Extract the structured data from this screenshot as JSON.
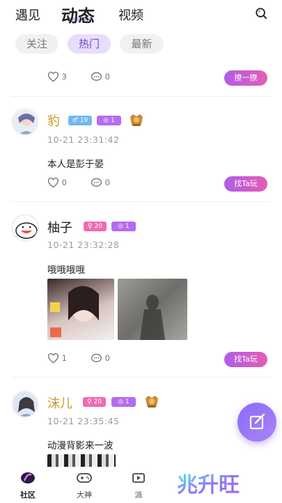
{
  "top_tabs": [
    "遇见",
    "动态",
    "视频"
  ],
  "filter_chips": [
    "关注",
    "热门",
    "最新"
  ],
  "posts": [
    {
      "likes": "3",
      "comments": "0",
      "button": "撩一撩"
    },
    {
      "name": "豹",
      "gender_badge": "♂ 19",
      "level_badge": "1",
      "time": "10-21 23:31:42",
      "text": "本人是彭于晏",
      "likes": "0",
      "comments": "0",
      "button": "找Ta玩"
    },
    {
      "name": "柚子",
      "gender_badge": "♀ 20",
      "level_badge": "1",
      "time": "10-21 23:32:28",
      "text": "哦哦哦哦",
      "likes": "1",
      "comments": "0",
      "button": "找Ta玩"
    },
    {
      "name": "沫儿",
      "gender_badge": "♀ 20",
      "level_badge": "1",
      "time": "10-21 23:35:45",
      "text": "动漫背影来一波"
    }
  ],
  "bottom_nav": [
    "社区",
    "大神",
    "派"
  ],
  "watermark": "兆升旺",
  "colors": {
    "accent": "#a78bfa",
    "button_gradient": [
      "#b05de8",
      "#e45db2"
    ],
    "gold_name": "#c99a2e"
  }
}
